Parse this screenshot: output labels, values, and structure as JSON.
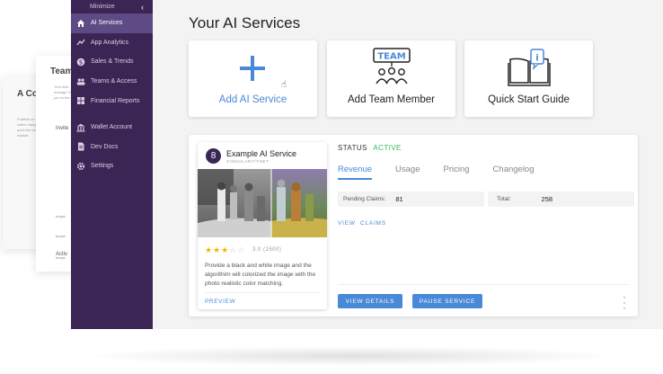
{
  "background_pages": {
    "page1": {
      "title": "A Co Publi",
      "text": "Publishi on easy to collec ready so Our publ hub for and the market."
    },
    "page2": {
      "title": "Team",
      "text": "Your fello manage Once you to the c",
      "invite": "Invite",
      "rows": [
        "tonyst",
        "tonyst",
        "tonyst"
      ],
      "active": "Activ"
    }
  },
  "sidebar": {
    "minimize_label": "Minimize",
    "items": [
      {
        "label": "AI Services",
        "icon": "home-icon",
        "active": true
      },
      {
        "label": "App Analytics",
        "icon": "chart-line-icon"
      },
      {
        "label": "Sales & Trends",
        "icon": "dollar-icon"
      },
      {
        "label": "Teams & Access",
        "icon": "people-icon"
      },
      {
        "label": "Financial Reports",
        "icon": "grid-icon"
      },
      {
        "label": "Wallet Account",
        "icon": "bank-icon"
      },
      {
        "label": "Dev Docs",
        "icon": "document-icon"
      },
      {
        "label": "Settings",
        "icon": "gear-icon"
      }
    ]
  },
  "main": {
    "title": "Your AI Services",
    "cards": [
      {
        "label": "Add AI Service",
        "icon": "plus-icon"
      },
      {
        "label": "Add Team Member",
        "icon": "team-icon"
      },
      {
        "label": "Quick Start Guide",
        "icon": "book-icon"
      }
    ],
    "service": {
      "logo_letter": "8",
      "name": "Example AI Service",
      "org": "SINGULARITYNET",
      "rating_stars": 3,
      "rating_max": 5,
      "rating_text": "3.0 (1500)",
      "description": "Provide a black and white image and the algorithim will colorized the image with the photo realistic color matching.",
      "preview_label": "PREVIEW",
      "status_label": "STATUS",
      "status_value": "ACTIVE",
      "tabs": [
        "Revenue",
        "Usage",
        "Pricing",
        "Changelog"
      ],
      "active_tab": "Revenue",
      "pending_claims_label": "Pending Claims:",
      "pending_claims_value": "81",
      "total_label": "Total:",
      "total_value": "258",
      "view_claims_label": "VIEW  CLAIMS",
      "view_details_label": "VIEW DETAILS",
      "pause_service_label": "PAUSE SERVICE"
    }
  },
  "colors": {
    "sidebar": "#3b2554",
    "accent": "#4a89d8",
    "active_status": "#2dbb5e"
  }
}
